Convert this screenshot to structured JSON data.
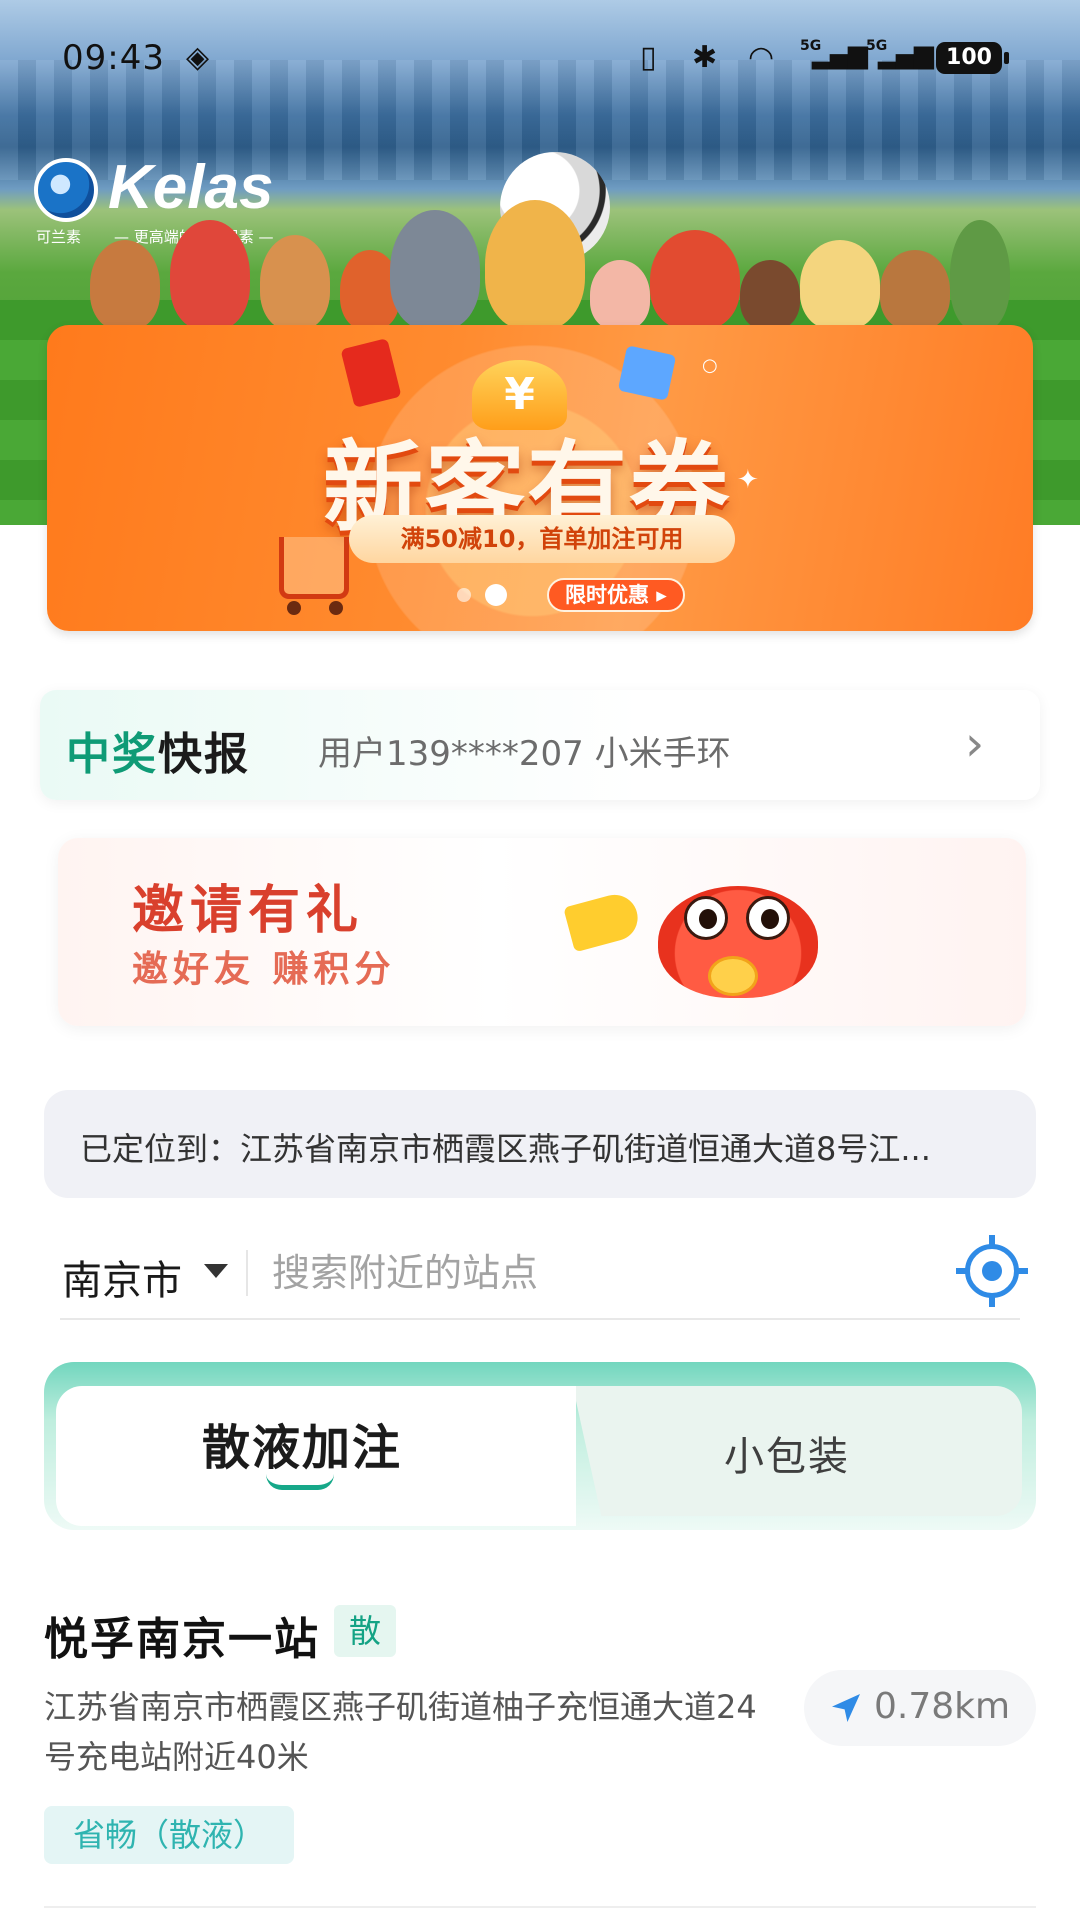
{
  "status_bar": {
    "time": "09:43",
    "network_1": "5G",
    "network_2": "5G",
    "battery": "100"
  },
  "hero": {
    "logo_text": "Kelas",
    "logo_cn": "可兰素",
    "logo_slogan": "— 更高端的车用尿素 —"
  },
  "banner": {
    "title": "新客有券",
    "subtitle": "满50减10，首单加注可用",
    "badge": "限时优惠 ▸",
    "yen_symbol": "¥",
    "slide_count": 2,
    "active_slide": 2
  },
  "news": {
    "title_green": "中奖",
    "title_dark": "快报",
    "text": "用户139****207 小米手环"
  },
  "invite": {
    "title": "邀请有礼",
    "subtitle": "邀好友  赚积分"
  },
  "location": {
    "text": "已定位到：江苏省南京市栖霞区燕子矶街道恒通大道8号江..."
  },
  "search": {
    "city": "南京市",
    "placeholder": "搜索附近的站点",
    "value": ""
  },
  "tabs": [
    {
      "label": "散液加注",
      "active": true
    },
    {
      "label": "小包装",
      "active": false
    }
  ],
  "station": {
    "name": "悦孚南京一站",
    "type_tag": "散",
    "address": "江苏省南京市栖霞区燕子矶街道柚子充恒通大道24号充电站附近40米",
    "distance": "0.78km",
    "fuel_tag": "省畅（散液）"
  },
  "colors": {
    "brand_green": "#14a385",
    "banner_orange": "#ff8b2f",
    "invite_red": "#d9402d",
    "accent_blue": "#2f8be6"
  }
}
